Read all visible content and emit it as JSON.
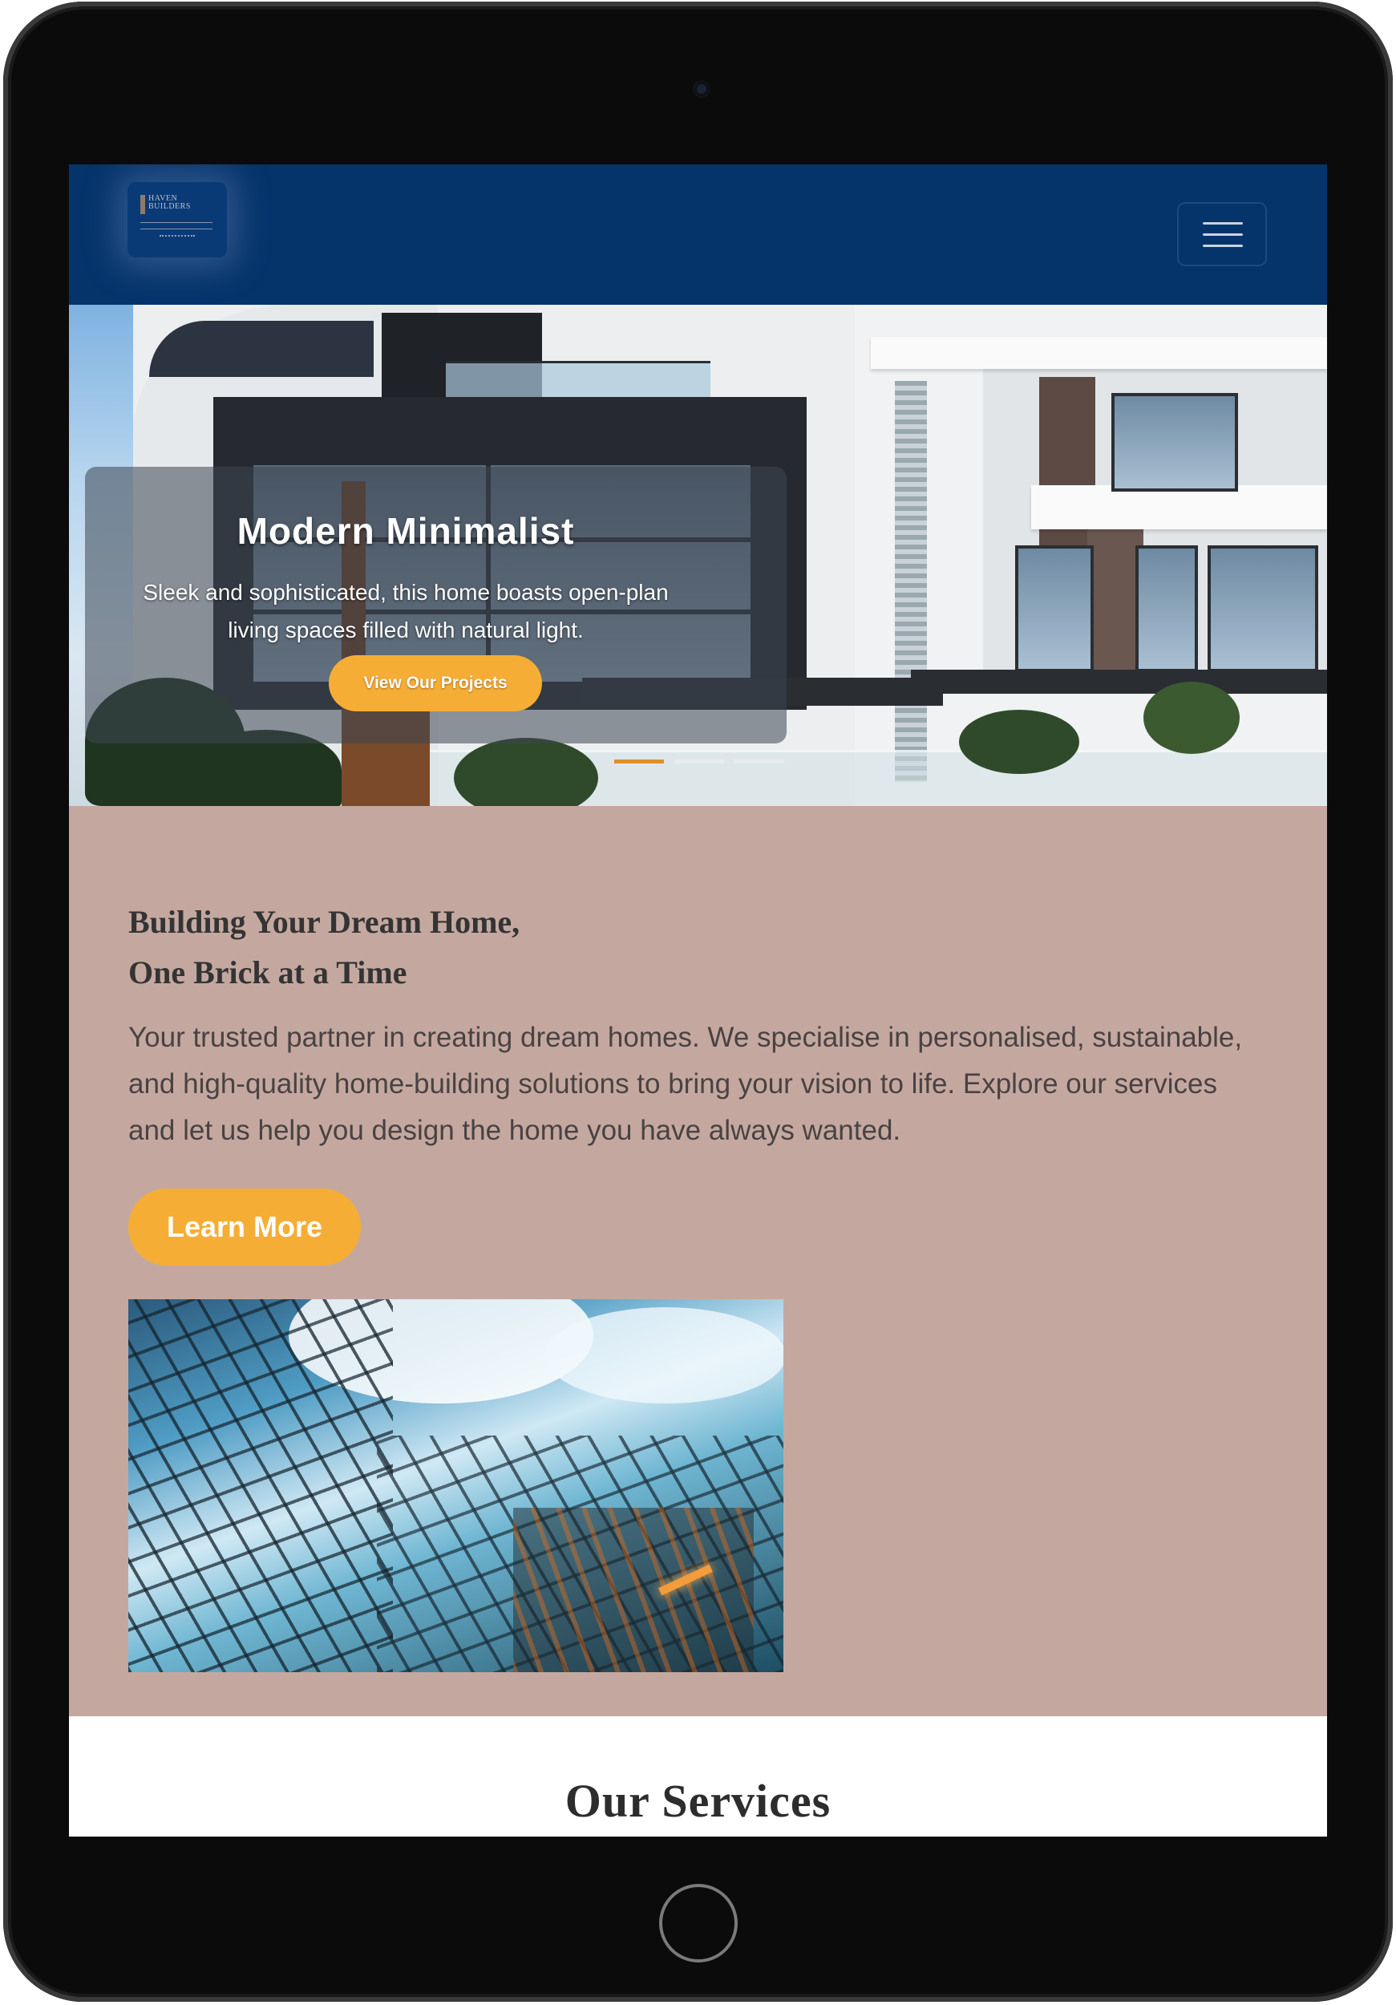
{
  "navbar": {
    "logo_text": "HAVEN BUILDERS",
    "menu_icon": "hamburger-menu-icon"
  },
  "hero": {
    "slide_title": "Modern Minimalist",
    "slide_text": "Sleek and sophisticated, this home boasts open-plan living spaces filled with natural light.",
    "button_label": "View Our Projects",
    "indicators": [
      {
        "active": true
      },
      {
        "active": false
      },
      {
        "active": false
      }
    ],
    "colors": {
      "accent": "#f6ad35",
      "indicator_active": "#e0902a",
      "indicator_inactive": "#e9ecef"
    }
  },
  "intro": {
    "heading_line1": "Building Your Dream Home,",
    "heading_line2": "One Brick at a Time",
    "paragraph": "Your trusted partner in creating dream homes. We specialise in personalised, sustainable, and high-quality home-building solutions to bring your vision to life. Explore our services and let us help you design the home you have always wanted.",
    "button_label": "Learn More",
    "background_color": "#c4a8a0"
  },
  "services": {
    "title": "Our Services"
  },
  "theme": {
    "navbar_color": "#05346b",
    "button_color": "#f6ad35"
  }
}
